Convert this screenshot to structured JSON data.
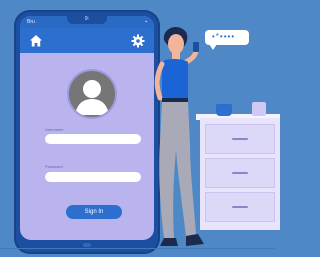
{
  "status_bar": {
    "left_text": "Bru",
    "notch_text": "9:",
    "right_text": "▪"
  },
  "app_bar": {
    "home_icon": "home-icon",
    "settings_icon": "gear-icon"
  },
  "login": {
    "avatar_icon": "user-avatar-icon",
    "username_label": "Username",
    "password_label": "Password",
    "signin_label": "Sign In"
  },
  "chat": {
    "masked_text": "•*••••"
  },
  "colors": {
    "background": "#4f88c6",
    "phone": "#1c4fa0",
    "screen": "#b9b3ee",
    "accent": "#2d6fce"
  }
}
